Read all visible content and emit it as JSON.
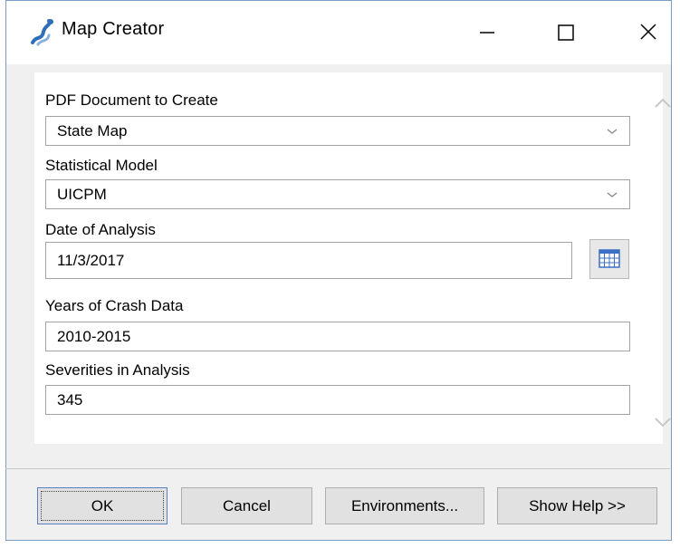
{
  "window": {
    "title": "Map Creator",
    "controls": {
      "minimize_icon": "minimize-icon",
      "maximize_icon": "maximize-icon",
      "close_icon": "close-icon"
    }
  },
  "form": {
    "pdf_document": {
      "label": "PDF Document to Create",
      "value": "State Map"
    },
    "statistical_model": {
      "label": "Statistical Model",
      "value": "UICPM"
    },
    "date_of_analysis": {
      "label": "Date of Analysis",
      "value": "11/3/2017",
      "picker_icon": "calendar-icon"
    },
    "years_of_crash_data": {
      "label": "Years of Crash Data",
      "value": "2010-2015"
    },
    "severities_in_analysis": {
      "label": "Severities in Analysis",
      "value": "345"
    }
  },
  "buttons": {
    "ok": "OK",
    "cancel": "Cancel",
    "environments": "Environments...",
    "show_help": "Show Help >>"
  },
  "colors": {
    "window_border": "#7a9bc2",
    "dialog_bg": "#f0f0f0",
    "button_bg": "#e1e1e1"
  }
}
